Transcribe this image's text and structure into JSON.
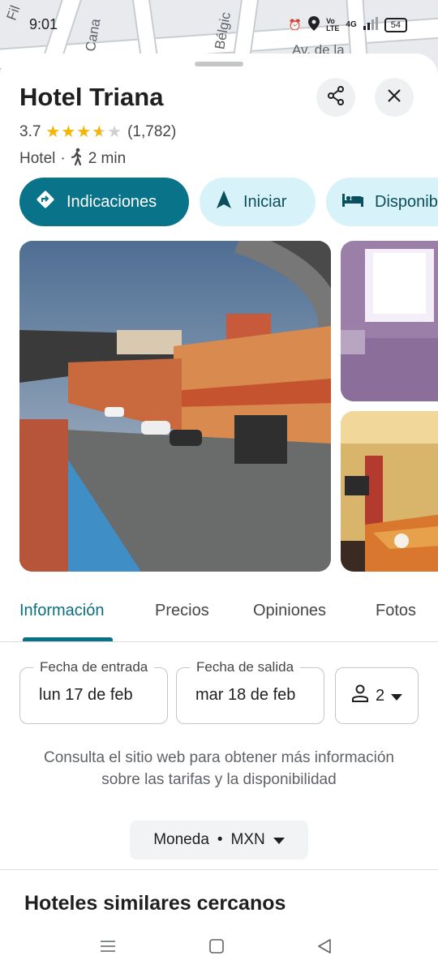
{
  "status_bar": {
    "time": "9:01",
    "battery": "54",
    "network": "4G"
  },
  "map": {
    "labels": [
      "Fil",
      "C. Cana",
      "Bélgic",
      "Av. de la"
    ]
  },
  "place": {
    "name": "Hotel Triana",
    "rating": "3.7",
    "stars_value": 3.7,
    "review_count": "(1,782)",
    "category": "Hotel",
    "separator": "·",
    "walk_time": "2 min"
  },
  "header_actions": {
    "share_icon": "share-icon",
    "close_icon": "close-icon"
  },
  "actions": {
    "directions_label": "Indicaciones",
    "start_label": "Iniciar",
    "availability_label": "Disponib"
  },
  "tabs": {
    "info": "Información",
    "prices": "Precios",
    "reviews": "Opiniones",
    "photos": "Fotos"
  },
  "booking": {
    "checkin_label": "Fecha de entrada",
    "checkin_value": "lun 17 de feb",
    "checkout_label": "Fecha de salida",
    "checkout_value": "mar 18 de feb",
    "guests": "2"
  },
  "note": "Consulta el sitio web para obtener más información sobre las tarifas y la disponibilidad",
  "currency": {
    "label": "Moneda",
    "dot": "•",
    "value": "MXN"
  },
  "similar_title": "Hoteles similares cercanos",
  "colors": {
    "accent": "#09738a",
    "chip_bg": "#d7f2f8",
    "star": "#f4b400"
  }
}
